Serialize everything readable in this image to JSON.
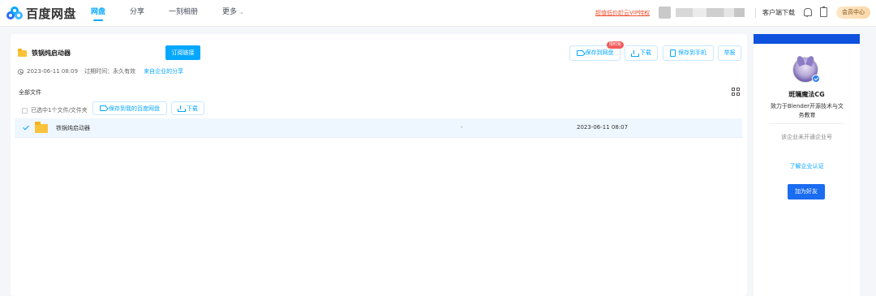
{
  "app": {
    "name": "百度网盘"
  },
  "nav": {
    "items": [
      {
        "label": "网盘",
        "active": true
      },
      {
        "label": "分享",
        "active": false
      },
      {
        "label": "一刻相册",
        "active": false
      },
      {
        "label": "更多",
        "active": false
      }
    ]
  },
  "header": {
    "promo": "超值低价赶云VIP特权",
    "client_download": "客户端下载",
    "member_center": "会员中心"
  },
  "share": {
    "title": "铁锅炖启动器",
    "subscribe_label": "订阅链接",
    "actions": {
      "save_to_disk": "保存到网盘",
      "save_badge": "限时免",
      "download": "下载",
      "save_to_phone": "保存到手机",
      "report": "举报"
    },
    "meta": {
      "created": "2023-06-11 08:09",
      "expire_label": "过期时间：永久有效",
      "enterprise_link": "来自企业的分享"
    }
  },
  "file_list": {
    "breadcrumb": "全部文件",
    "selected_info": "已选中1个文件/文件夹",
    "save_to_my": "保存到我的百度网盘",
    "download": "下载",
    "rows": [
      {
        "name": "铁锅炖启动器",
        "size": "-",
        "date": "2023-06-11 08:07",
        "selected": true
      }
    ]
  },
  "sidebar": {
    "name": "斑斓魔法CG",
    "description": "致力于Blender开源技术与文务教育",
    "enterprise_status": "该企业未开通企业号",
    "learn_link": "了解企业认证",
    "add_friend": "加为好友"
  },
  "colors": {
    "accent": "#06a7ff",
    "promo": "#f0502e",
    "primary_button": "#1a6cf0"
  }
}
